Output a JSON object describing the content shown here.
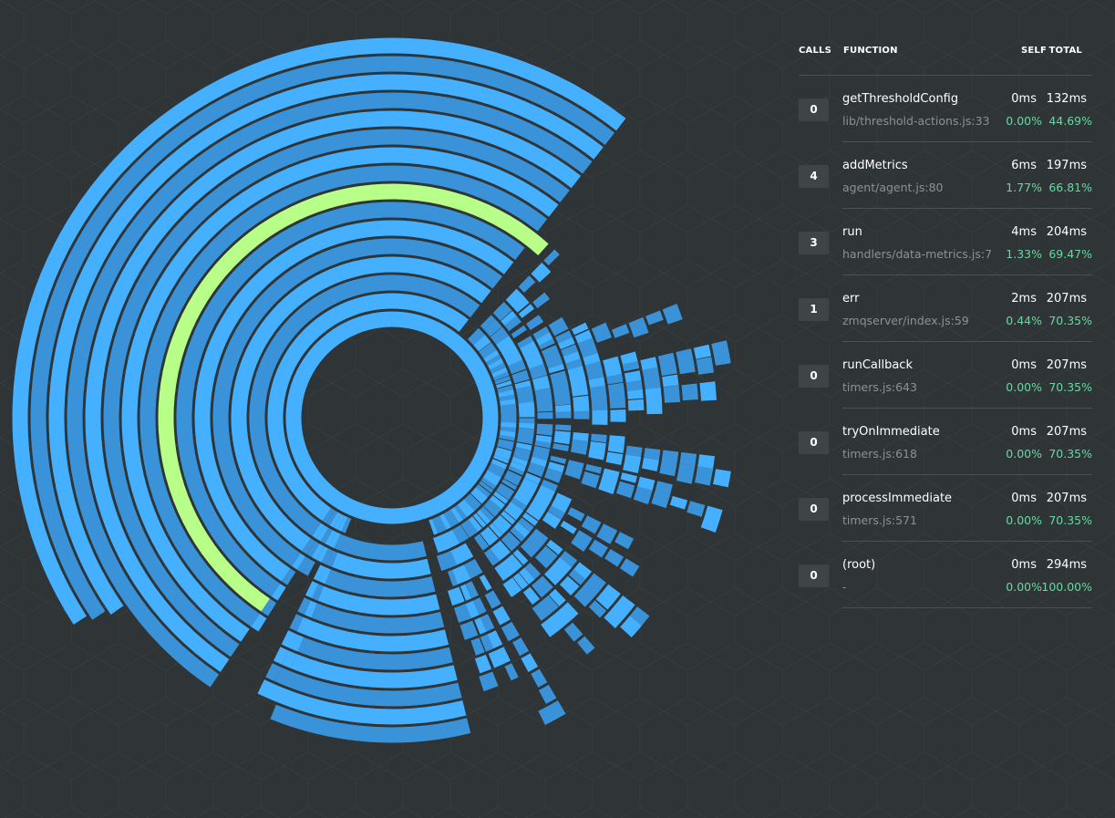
{
  "colors": {
    "background": "#2f3436",
    "arc_primary": "#45b0ff",
    "arc_secondary": "#3a93d9",
    "arc_selected": "#b8ff8a",
    "percent_text": "#66d9a0",
    "file_text": "#8c9294"
  },
  "table": {
    "headers": {
      "calls": "CALLS",
      "function": "FUNCTION",
      "self": "SELF",
      "total": "TOTAL"
    },
    "rows": [
      {
        "calls": "0",
        "name": "getThresholdConfig",
        "file": "lib/threshold-actions.js:33",
        "self_ms": "0ms",
        "total_ms": "132ms",
        "self_pct": "0.00%",
        "total_pct": "44.69%"
      },
      {
        "calls": "4",
        "name": "addMetrics",
        "file": "agent/agent.js:80",
        "self_ms": "6ms",
        "total_ms": "197ms",
        "self_pct": "1.77%",
        "total_pct": "66.81%"
      },
      {
        "calls": "3",
        "name": "run",
        "file": "handlers/data-metrics.js:7",
        "self_ms": "4ms",
        "total_ms": "204ms",
        "self_pct": "1.33%",
        "total_pct": "69.47%"
      },
      {
        "calls": "1",
        "name": "err",
        "file": "zmqserver/index.js:59",
        "self_ms": "2ms",
        "total_ms": "207ms",
        "self_pct": "0.44%",
        "total_pct": "70.35%"
      },
      {
        "calls": "0",
        "name": "runCallback",
        "file": "timers.js:643",
        "self_ms": "0ms",
        "total_ms": "207ms",
        "self_pct": "0.00%",
        "total_pct": "70.35%"
      },
      {
        "calls": "0",
        "name": "tryOnImmediate",
        "file": "timers.js:618",
        "self_ms": "0ms",
        "total_ms": "207ms",
        "self_pct": "0.00%",
        "total_pct": "70.35%"
      },
      {
        "calls": "0",
        "name": "processImmediate",
        "file": "timers.js:571",
        "self_ms": "0ms",
        "total_ms": "207ms",
        "self_pct": "0.00%",
        "total_pct": "70.35%"
      },
      {
        "calls": "0",
        "name": "(root)",
        "file": "-",
        "self_ms": "0ms",
        "total_ms": "294ms",
        "self_pct": "0.00%",
        "total_pct": "100.00%"
      }
    ]
  },
  "sunburst": {
    "selected_function": "getThresholdConfig",
    "selected_ring_depth": 7
  }
}
